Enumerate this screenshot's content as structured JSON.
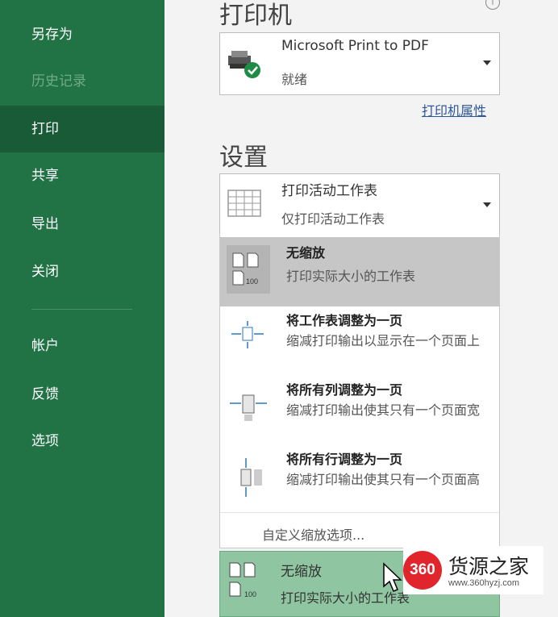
{
  "sidebar": {
    "items": [
      {
        "label": "另存为",
        "state": "normal"
      },
      {
        "label": "历史记录",
        "state": "disabled"
      },
      {
        "label": "打印",
        "state": "active"
      },
      {
        "label": "共享",
        "state": "normal"
      },
      {
        "label": "导出",
        "state": "normal"
      },
      {
        "label": "关闭",
        "state": "normal"
      },
      {
        "label": "帐户",
        "state": "normal"
      },
      {
        "label": "反馈",
        "state": "normal"
      },
      {
        "label": "选项",
        "state": "normal"
      }
    ]
  },
  "printer": {
    "section_title": "打印机",
    "name": "Microsoft Print to PDF",
    "status": "就绪",
    "properties_link": "打印机属性"
  },
  "settings": {
    "section_title": "设置",
    "scope_title": "打印活动工作表",
    "scope_sub": "仅打印活动工作表"
  },
  "scaling_menu": {
    "items": [
      {
        "title": "无缩放",
        "desc": "打印实际大小的工作表",
        "selected": true,
        "icon": "no-scaling-icon"
      },
      {
        "title": "将工作表调整为一页",
        "desc": "缩减打印输出以显示在一个页面上",
        "selected": false,
        "icon": "fit-sheet-icon"
      },
      {
        "title": "将所有列调整为一页",
        "desc": "缩减打印输出使其只有一个页面宽",
        "selected": false,
        "icon": "fit-columns-icon"
      },
      {
        "title": "将所有行调整为一页",
        "desc": "缩减打印输出使其只有一个页面高",
        "selected": false,
        "icon": "fit-rows-icon"
      }
    ],
    "custom_option": "自定义缩放选项..."
  },
  "current_scaling": {
    "title": "无缩放",
    "sub": "打印实际大小的工作表"
  },
  "watermark": {
    "logo_text": "360",
    "brand": "货源之家",
    "url": "www.360hyzj.com"
  },
  "colors": {
    "sidebar": "#217346",
    "sidebar_active": "#195a37",
    "selected_menu": "#c6c6c6",
    "current_option": "#8fc5a0"
  }
}
